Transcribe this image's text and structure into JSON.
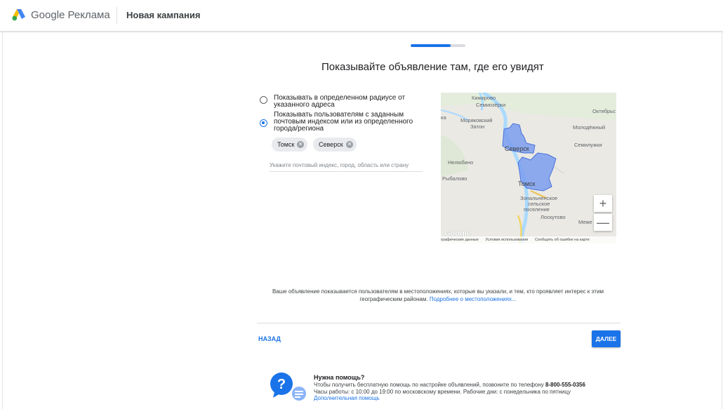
{
  "header": {
    "brand_google": "Google",
    "brand_product": "Реклама",
    "campaign_title": "Новая кампания"
  },
  "progress": {
    "fraction": 0.73
  },
  "heading": "Показывайте объявление там, где его увидят",
  "options": {
    "radius_label": "Показывать в определенном радиусе от указанного адреса",
    "postal_label": "Показывать пользователям с заданным почтовым индексом или из определенного города/региона",
    "selected": "postal"
  },
  "chips": [
    "Томск",
    "Северск"
  ],
  "location_input": {
    "placeholder": "Укажите почтовый индекс, город, область или страну",
    "value": ""
  },
  "map": {
    "labels": {
      "kizhirovo": "Кижирово",
      "semiozerki": "Семиозёрки",
      "oktyabrsky": "Октябрьс",
      "moryakovsky": "Моряковский",
      "zaton": "Затон",
      "ka": "ка",
      "molodezhny": "Молодёжный",
      "seversk": "Северск",
      "semiluzhki": "Семилужки",
      "nelyubino": "Нелюбино",
      "rybalovo": "Рыбалово",
      "tomsk": "Томск",
      "zonalnoe1": "Зональненское",
      "zonalnoe2": "сельское",
      "zonalnoe3": "поселение",
      "loskutovo": "Лоскутово",
      "mezhe": "Меже"
    },
    "zoom_in": "+",
    "zoom_out": "—",
    "google_logo": "Google",
    "footer": {
      "data": "графические данные",
      "terms": "Условия использования",
      "report": "Сообщить об ошибке на карте"
    },
    "colors": {
      "region_fill": "#7b9ef0",
      "region_stroke": "#4a73d9",
      "river": "#aadaff"
    }
  },
  "description": {
    "text": "Ваше объявление показывается пользователям в местоположениях, которые вы указали, и тем, кто проявляет интерес к этим географическим районам.",
    "link": "Подробнее о местоположениях..."
  },
  "nav": {
    "back": "НАЗАД",
    "next": "ДАЛЕЕ"
  },
  "help": {
    "title": "Нужна помощь?",
    "line1": "Чтобы получить бесплатную помощь по настройке объявлений, позвоните по телефону",
    "phone": "8-800-555-0356",
    "line2": "Часы работы: с 10:00 до 19:00 по московскому времени. Рабочие дни: с понедельника по пятницу",
    "link": "Дополнительная помощь"
  }
}
